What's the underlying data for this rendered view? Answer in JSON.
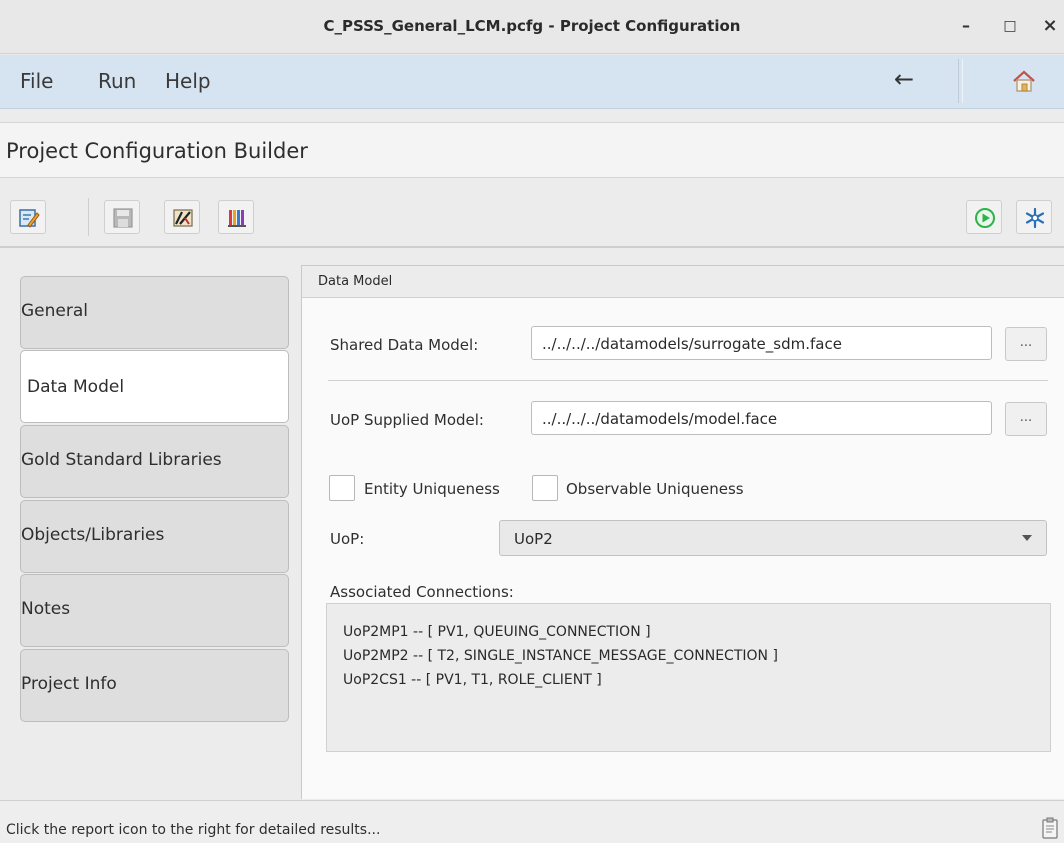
{
  "window": {
    "title": "C_PSSS_General_LCM.pcfg - Project Configuration",
    "minimize": "–",
    "maximize": "□",
    "close": "×"
  },
  "menu": {
    "items": [
      "File",
      "Run",
      "Help"
    ],
    "back_icon": "back-arrow-icon",
    "home_icon": "home-icon"
  },
  "builder": {
    "title": "Project Configuration Builder"
  },
  "toolbar": {
    "left_icons": [
      "edit-icon",
      "save-icon",
      "validate-icon",
      "report-chart-icon"
    ],
    "right_icons": [
      "run-icon",
      "settings-snowflake-icon"
    ]
  },
  "tabs": [
    {
      "label": "General",
      "active": false
    },
    {
      "label": "Data Model",
      "active": true
    },
    {
      "label": "Gold Standard Libraries",
      "active": false
    },
    {
      "label": "Objects/Libraries",
      "active": false
    },
    {
      "label": "Notes",
      "active": false
    },
    {
      "label": "Project Info",
      "active": false
    }
  ],
  "panel": {
    "title": "Data Model",
    "shared_label": "Shared Data Model:",
    "shared_value": "../../../../datamodels/surrogate_sdm.face",
    "uop_supplied_label": "UoP Supplied Model:",
    "uop_supplied_value": "../../../../datamodels/model.face",
    "browse_label": "...",
    "entity_uniqueness": "Entity Uniqueness",
    "observable_uniqueness": "Observable Uniqueness",
    "uop_label": "UoP:",
    "uop_value": "UoP2",
    "associated_label": "Associated Connections:",
    "connections": [
      "UoP2MP1 -- [ PV1, QUEUING_CONNECTION ]",
      "UoP2MP2 -- [ T2, SINGLE_INSTANCE_MESSAGE_CONNECTION ]",
      "UoP2CS1 -- [ PV1, T1, ROLE_CLIENT ]"
    ]
  },
  "status": {
    "message": "Click the report icon to the right for detailed results...",
    "icon": "report-clipboard-icon"
  },
  "colors": {
    "menu_bg": "#d6e3f0",
    "run_green": "#2fb24a",
    "snowflake_blue": "#2a6fb5"
  }
}
